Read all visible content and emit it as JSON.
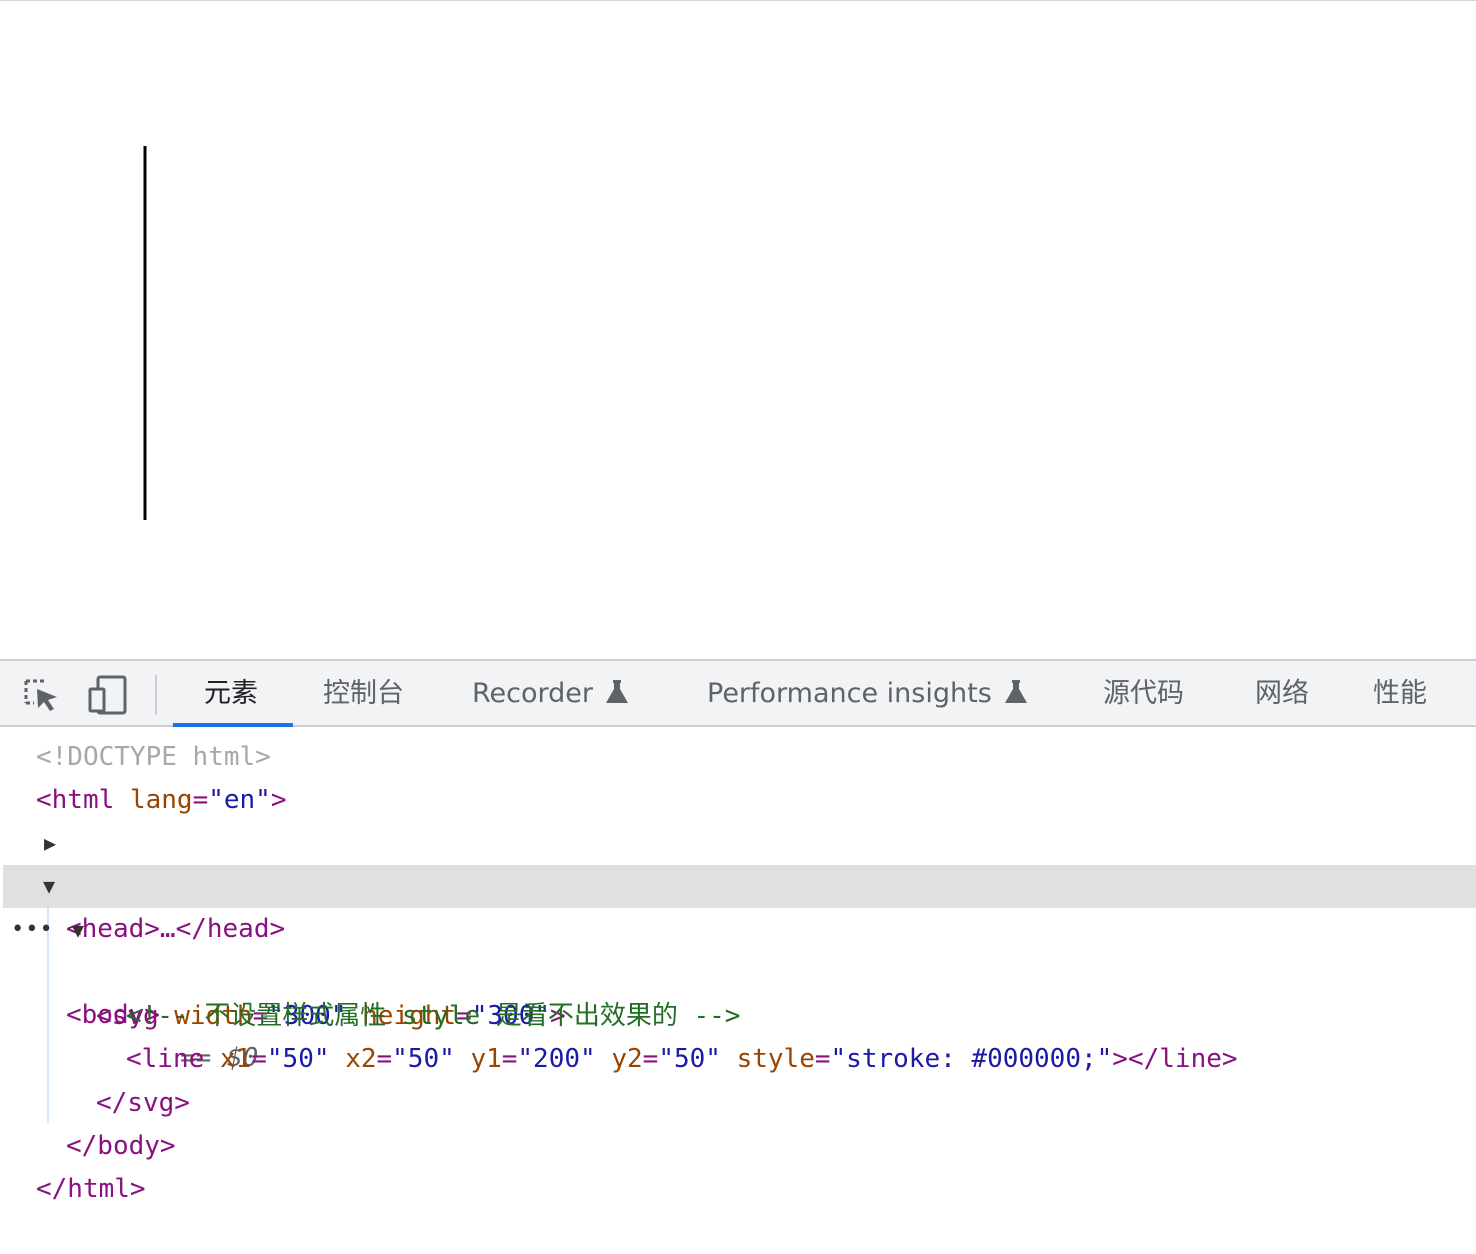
{
  "viewport": {
    "line": {
      "x1": "50",
      "x2": "50",
      "y1": "200",
      "y2": "50",
      "stroke": "#000000"
    }
  },
  "toolbar": {
    "inspect_icon": "inspect-element-icon",
    "device_icon": "device-toolbar-icon",
    "tabs": [
      {
        "label": "元素",
        "active": true
      },
      {
        "label": "控制台"
      },
      {
        "label": "Recorder",
        "experimental": true
      },
      {
        "label": "Performance insights",
        "experimental": true
      },
      {
        "label": "源代码"
      },
      {
        "label": "网络"
      },
      {
        "label": "性能"
      }
    ],
    "accent_color": "#1a73e8"
  },
  "dom": {
    "doctype": "<!DOCTYPE html>",
    "html_open": "<html",
    "html_attr": "lang",
    "html_attr_value": "\"en\"",
    "head": "<head>…</head>",
    "body_open": "<body>",
    "selected_marker": "== $0",
    "svg_tag": "<svg",
    "svg_width_attr": "width",
    "svg_width_value": "\"300\"",
    "svg_height_attr": "height",
    "svg_height_value": "\"300\"",
    "comment": "<!-- 不设置样式属性 style 是看不出效果的 -->",
    "line_tag": "<line",
    "line_x1_attr": "x1",
    "line_x1_value": "\"50\"",
    "line_x2_attr": "x2",
    "line_x2_value": "\"50\"",
    "line_y1_attr": "y1",
    "line_y1_value": "\"200\"",
    "line_y2_attr": "y2",
    "line_y2_value": "\"50\"",
    "line_style_attr": "style",
    "line_style_value": "\"stroke: #000000;\"",
    "line_close": "></line>",
    "svg_close": "</svg>",
    "body_close": "</body>",
    "html_close": "</html>"
  }
}
